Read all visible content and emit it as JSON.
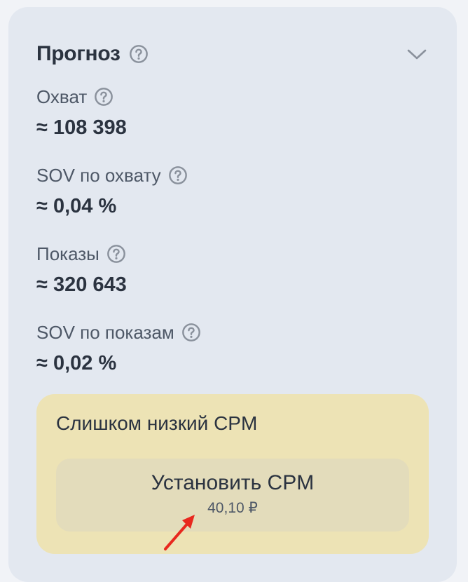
{
  "forecast": {
    "title": "Прогноз",
    "metrics": [
      {
        "label": "Охват",
        "value": "≈ 108 398"
      },
      {
        "label": "SOV по охвату",
        "value": "≈ 0,04 %"
      },
      {
        "label": "Показы",
        "value": "≈ 320 643"
      },
      {
        "label": "SOV по показам",
        "value": "≈ 0,02 %"
      }
    ],
    "warning": {
      "text": "Слишком низкий CPM",
      "button_label": "Установить CPM",
      "button_price": "40,10 ₽"
    }
  },
  "colors": {
    "panel_bg": "#e3e8f0",
    "warning_bg": "#ede3b5",
    "button_bg": "#e3dcbb",
    "text_primary": "#2b3340",
    "text_secondary": "#4e5867",
    "arrow": "#e8281e"
  },
  "icons": {
    "help": "question-circle-icon",
    "collapse": "chevron-down-icon",
    "annotation": "red-arrow-icon"
  }
}
